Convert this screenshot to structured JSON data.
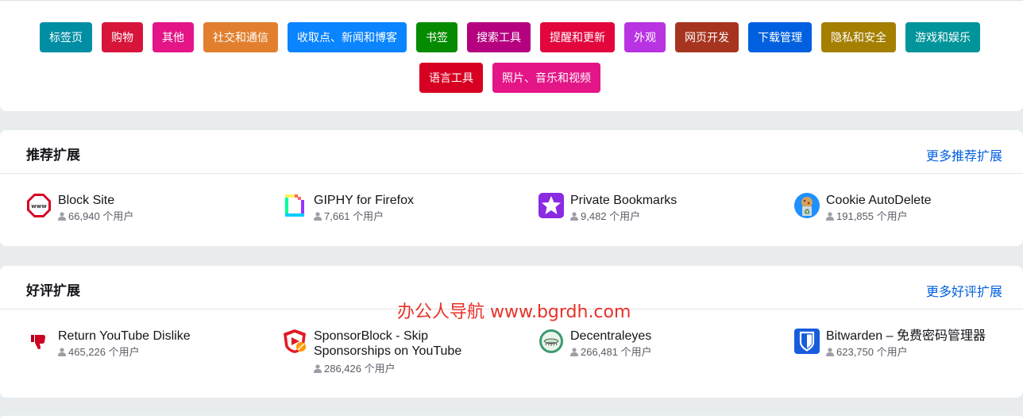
{
  "categories": [
    {
      "label": "标签页",
      "color": "#008ea4"
    },
    {
      "label": "购物",
      "color": "#d7143a"
    },
    {
      "label": "其他",
      "color": "#e31587"
    },
    {
      "label": "社交和通信",
      "color": "#e27f2e"
    },
    {
      "label": "收取点、新闻和博客",
      "color": "#0a84ff"
    },
    {
      "label": "书签",
      "color": "#058b00"
    },
    {
      "label": "搜索工具",
      "color": "#b5007f"
    },
    {
      "label": "提醒和更新",
      "color": "#e2063d"
    },
    {
      "label": "外观",
      "color": "#b833e1"
    },
    {
      "label": "网页开发",
      "color": "#a7341f"
    },
    {
      "label": "下载管理",
      "color": "#0060df"
    },
    {
      "label": "隐私和安全",
      "color": "#a47f00"
    },
    {
      "label": "游戏和娱乐",
      "color": "#00949b"
    },
    {
      "label": "语言工具",
      "color": "#d70022"
    },
    {
      "label": "照片、音乐和视频",
      "color": "#e31587"
    }
  ],
  "recommended": {
    "title": "推荐扩展",
    "more": "更多推荐扩展",
    "items": [
      {
        "name": "Block Site",
        "users": "66,940 个用户",
        "icon": "www-stop-icon"
      },
      {
        "name": "GIPHY for Firefox",
        "users": "7,661 个用户",
        "icon": "giphy-icon"
      },
      {
        "name": "Private Bookmarks",
        "users": "9,482 个用户",
        "icon": "star-icon"
      },
      {
        "name": "Cookie AutoDelete",
        "users": "191,855 个用户",
        "icon": "cookie-recycle-icon"
      }
    ]
  },
  "top_rated": {
    "title": "好评扩展",
    "more": "更多好评扩展",
    "items": [
      {
        "name": "Return YouTube Dislike",
        "users": "465,226 个用户",
        "icon": "thumbs-down-icon"
      },
      {
        "name_line1": "SponsorBlock - Skip",
        "name_line2": "Sponsorships on YouTube",
        "users": "286,426 个用户",
        "icon": "sponsorblock-icon"
      },
      {
        "name": "Decentraleyes",
        "users": "266,481 个用户",
        "icon": "decentraleyes-icon"
      },
      {
        "name": "Bitwarden – 免费密码管理器",
        "users": "623,750 个用户",
        "icon": "bitwarden-shield-icon"
      }
    ]
  },
  "watermark": "办公人导航 www.bgrdh.com"
}
